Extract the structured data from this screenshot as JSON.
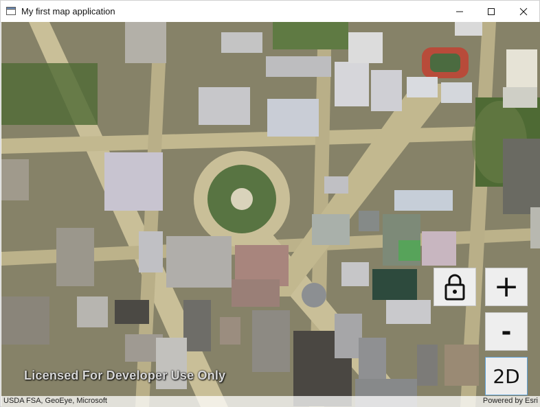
{
  "window": {
    "title": "My first map application",
    "controls": {
      "minimize": "minimize-icon",
      "maximize": "maximize-icon",
      "close": "close-icon"
    }
  },
  "map": {
    "license_text": "Licensed For Developer Use Only",
    "attribution": "USDA FSA, GeoEye, Microsoft",
    "powered_by": "Powered by Esri",
    "controls": {
      "lock_icon": "lock-icon",
      "zoom_in": "+",
      "zoom_out": "-",
      "view_mode": "2D"
    }
  },
  "colors": {
    "ground": "#8f8a70",
    "road": "#c9bf98",
    "park": "#4f6a35",
    "building_light": "#cfcfd6",
    "building_dark": "#4a4a44",
    "control_bg": "#eeeeee"
  }
}
